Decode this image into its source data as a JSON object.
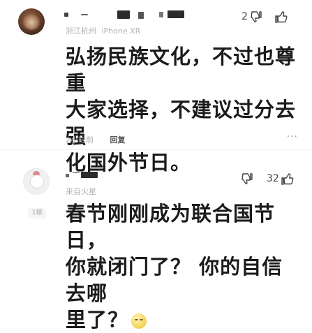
{
  "comment1": {
    "location": "浙江杭州",
    "device": "iPhone XR",
    "dislike_count": "2",
    "body_lines": [
      "弘扬民族文化，不过也尊重",
      "大家选择，不建议过分去强",
      "化国外节日。"
    ],
    "time": "2小时前",
    "reply_label": "回复",
    "more_label": "···"
  },
  "comment2": {
    "badge": "1楼",
    "location": "来自火星",
    "like_count": "32",
    "body_lines": [
      "春节刚刚成为联合国节日，",
      "你就闭门了？ 你的自信去哪",
      "里了？"
    ],
    "emoji": "thinking-face-icon"
  }
}
